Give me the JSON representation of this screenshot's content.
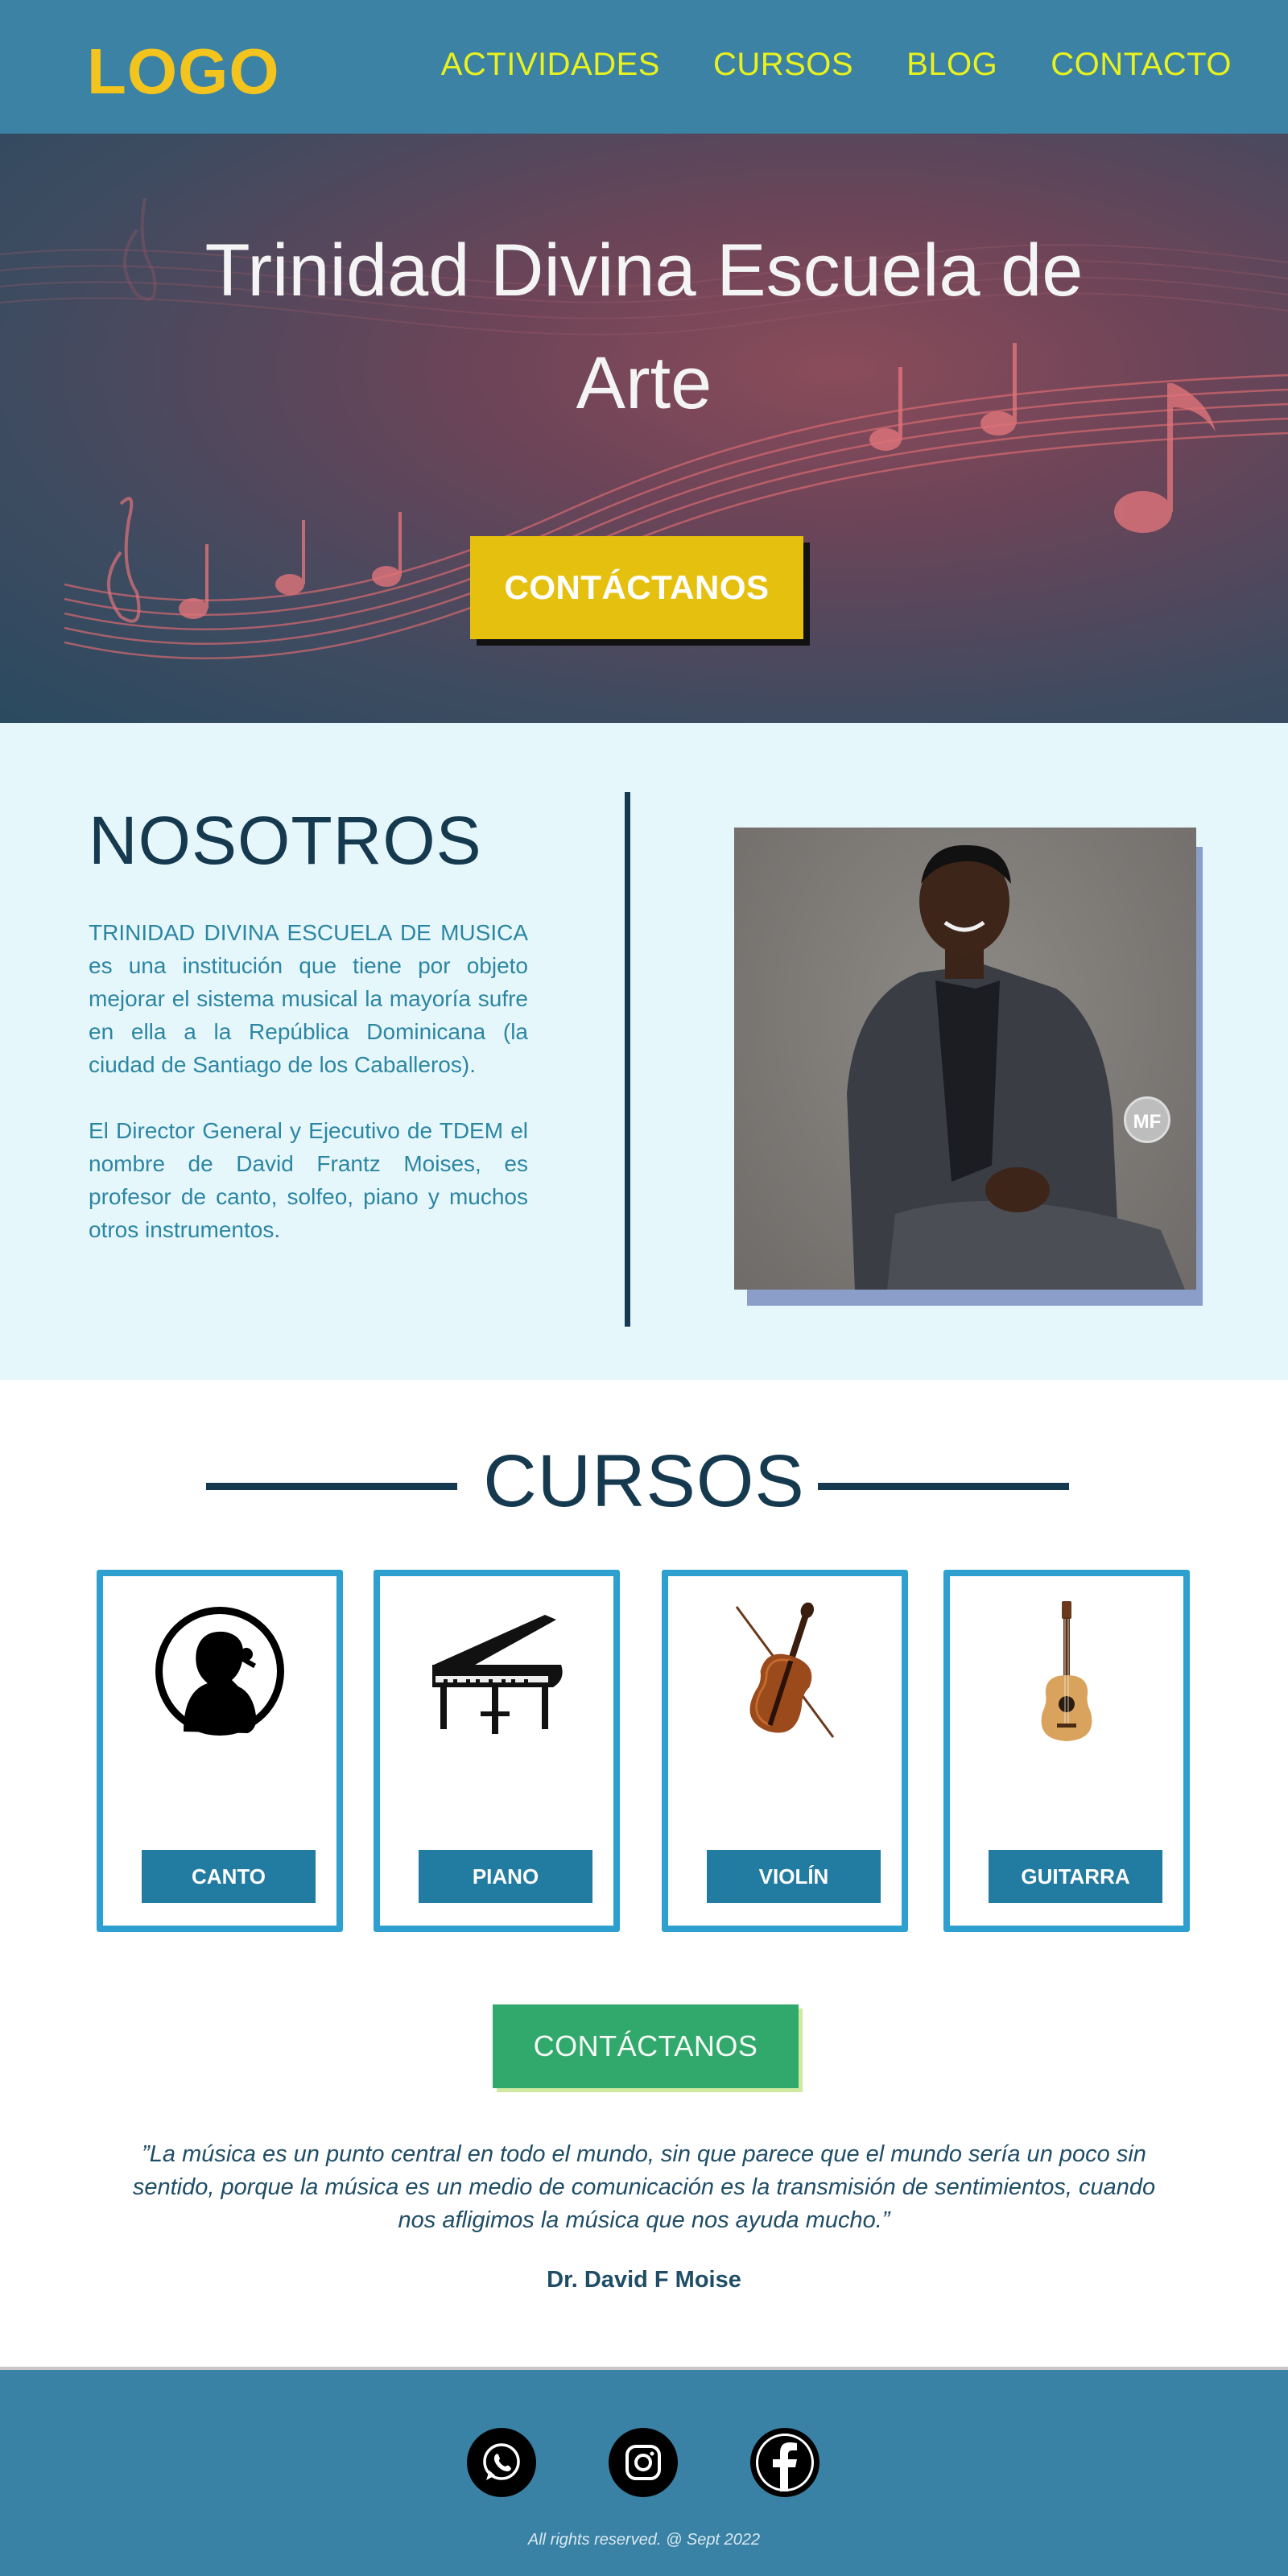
{
  "header": {
    "logo": "LOGO",
    "nav": [
      "ACTIVIDADES",
      "CURSOS",
      "BLOG",
      "CONTACTO"
    ]
  },
  "hero": {
    "title": "Trinidad Divina Escuela de Arte",
    "button": "CONTÁCTANOS"
  },
  "about": {
    "title": "NOSOTROS",
    "paragraphs": [
      "TRINIDAD DIVINA ESCUELA DE MUSICA es una institución que tiene por objeto mejorar el sistema musical la mayoría sufre en ella a la República Dominicana (la ciudad de Santiago de los Caballeros).",
      "El Director General y Ejecutivo de TDEM el nombre de David Frantz Moises, es profesor de canto, solfeo, piano y muchos otros instrumentos."
    ],
    "photo_badge": "MF"
  },
  "courses": {
    "title": "CURSOS",
    "items": [
      {
        "label": "CANTO",
        "icon": "singer-icon"
      },
      {
        "label": "PIANO",
        "icon": "piano-icon"
      },
      {
        "label": "VIOLÍN",
        "icon": "violin-icon"
      },
      {
        "label": "GUITARRA",
        "icon": "guitar-icon"
      }
    ],
    "contact_button": "CONTÁCTANOS"
  },
  "quote": {
    "text": "”La música es un punto central en todo el mundo, sin que parece que el mundo sería un poco sin sentido, porque la música es un medio de comunicación es la transmisión de sentimientos, cuando nos afligimos la música que nos ayuda mucho.”",
    "author": "Dr. David F Moise"
  },
  "footer": {
    "social": [
      "whatsapp-icon",
      "instagram-icon",
      "facebook-icon"
    ],
    "copyright": "All rights reserved. @ Sept 2022"
  },
  "colors": {
    "header_bg": "#3b82a5",
    "logo": "#f2c41d",
    "nav": "#e9f21d",
    "hero_button": "#e6c00f",
    "about_bg": "#e6f7fb",
    "dark_navy": "#15394f",
    "card_border": "#2ea0d0",
    "card_button": "#227ba0",
    "green_button": "#31a86c",
    "footer_bg": "#3982a5"
  }
}
